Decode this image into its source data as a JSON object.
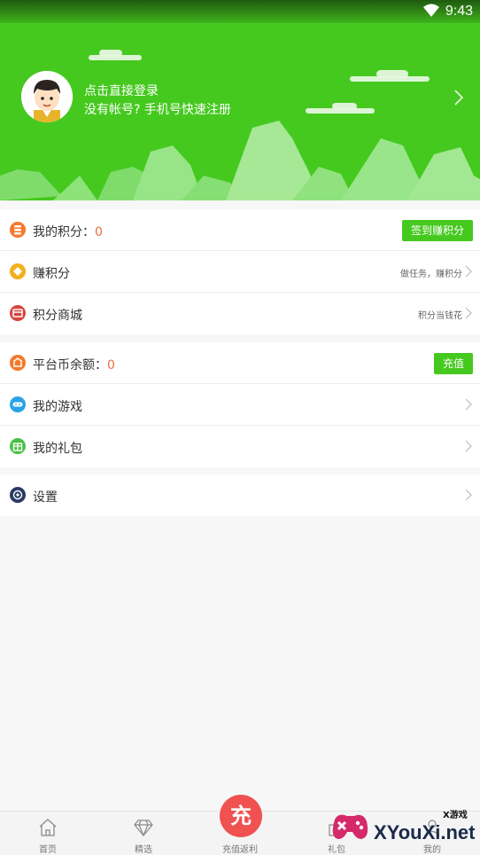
{
  "status": {
    "time": "9:43"
  },
  "header": {
    "login_title": "点击直接登录",
    "login_sub": "没有帐号? 手机号快速注册",
    "bg": "#45c91f"
  },
  "group1": {
    "points": {
      "label": "我的积分：",
      "value": "0",
      "button": "签到赚积分",
      "icon_color": "#f47a2a"
    },
    "earn": {
      "label": "赚积分",
      "hint": "做任务，赚积分",
      "icon_color": "#f2b01e"
    },
    "mall": {
      "label": "积分商城",
      "hint": "积分当钱花",
      "icon_color": "#d8443a"
    }
  },
  "group2": {
    "balance": {
      "label": "平台币余额：",
      "value": "0",
      "button": "充值",
      "icon_color": "#f47a2a"
    },
    "games": {
      "label": "我的游戏",
      "icon_color": "#2aa3e8"
    },
    "gifts": {
      "label": "我的礼包",
      "icon_color": "#48c245"
    }
  },
  "group3": {
    "settings": {
      "label": "设置",
      "icon_color": "#2a3a66"
    }
  },
  "nav": {
    "home": "首页",
    "featured": "精选",
    "recharge": "充值返利",
    "recharge_char": "充",
    "gift": "礼包",
    "mine": "我的"
  },
  "watermark": {
    "small": "X游戏",
    "text": "XYouXi.net"
  }
}
